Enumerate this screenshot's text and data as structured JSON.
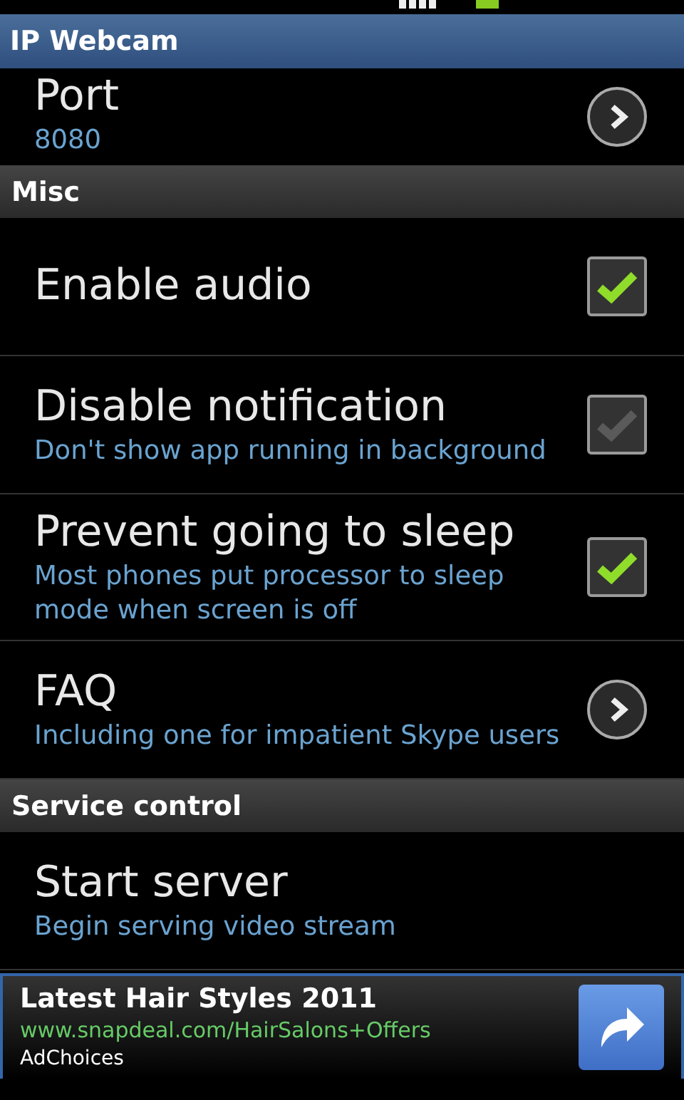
{
  "title_bar": {
    "title": "IP Webcam"
  },
  "sections": [
    {
      "items": [
        {
          "kind": "link",
          "title": "Port",
          "summary": "8080"
        }
      ]
    },
    {
      "header": "Misc",
      "items": [
        {
          "kind": "checkbox",
          "title": "Enable audio",
          "checked": true
        },
        {
          "kind": "checkbox",
          "title": "Disable notification",
          "summary": "Don't show app running in background",
          "checked": false
        },
        {
          "kind": "checkbox",
          "title": "Prevent going to sleep",
          "summary": "Most phones put processor to sleep mode when screen is off",
          "checked": true
        },
        {
          "kind": "link",
          "title": "FAQ",
          "summary": "Including one for impatient Skype users"
        }
      ]
    },
    {
      "header": "Service control",
      "items": [
        {
          "kind": "plain",
          "title": "Start server",
          "summary": "Begin serving video stream"
        }
      ]
    }
  ],
  "ad": {
    "headline": "Latest Hair Styles 2011",
    "url": "www.snapdeal.com/HairSalons+Offers",
    "choices": "AdChoices"
  }
}
